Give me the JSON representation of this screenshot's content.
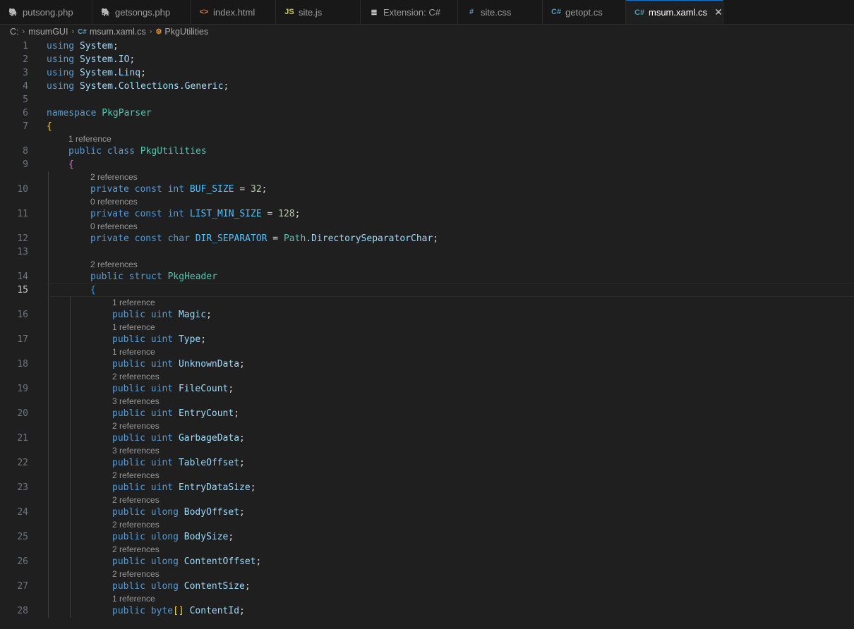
{
  "tabs": [
    {
      "name": "tab-putsong",
      "label": "putsong.php",
      "icon": "php-icon",
      "glyph": "🐘",
      "color": "#a074c4",
      "width": 131,
      "active": false
    },
    {
      "name": "tab-getsongs",
      "label": "getsongs.php",
      "icon": "php-icon",
      "glyph": "🐘",
      "color": "#a074c4",
      "width": 139,
      "active": false
    },
    {
      "name": "tab-index",
      "label": "index.html",
      "icon": "html-icon",
      "glyph": "<>",
      "color": "#e37933",
      "width": 121,
      "active": false
    },
    {
      "name": "tab-site-js",
      "label": "site.js",
      "icon": "js-icon",
      "glyph": "JS",
      "color": "#cbcb41",
      "width": 120,
      "active": false
    },
    {
      "name": "tab-extension",
      "label": "Extension: C#",
      "icon": "extension-icon",
      "glyph": "≣",
      "color": "#cccccc",
      "width": 138,
      "active": false
    },
    {
      "name": "tab-site-css",
      "label": "site.css",
      "icon": "css-icon",
      "glyph": "#",
      "color": "#519aba",
      "width": 120,
      "active": false
    },
    {
      "name": "tab-getopt",
      "label": "getopt.cs",
      "icon": "csharp-icon",
      "glyph": "C#",
      "color": "#519aba",
      "width": 118,
      "active": false
    },
    {
      "name": "tab-msum-xaml",
      "label": "msum.xaml.cs",
      "icon": "csharp-icon",
      "glyph": "C#",
      "color": "#519aba",
      "width": 138,
      "active": true,
      "close": "✕"
    }
  ],
  "breadcrumb": {
    "drive": "C:",
    "folder": "msumGUI",
    "file": "msum.xaml.cs",
    "symbol": "PkgUtilities",
    "separator": "›"
  },
  "editor": {
    "current_line": 15,
    "lines": [
      {
        "n": 1,
        "indent": 0,
        "tokens": [
          [
            "kw",
            "using"
          ],
          [
            "plain",
            " "
          ],
          [
            "ns",
            "System"
          ],
          [
            "plain",
            ";"
          ]
        ]
      },
      {
        "n": 2,
        "indent": 0,
        "tokens": [
          [
            "kw",
            "using"
          ],
          [
            "plain",
            " "
          ],
          [
            "ns",
            "System.IO"
          ],
          [
            "plain",
            ";"
          ]
        ]
      },
      {
        "n": 3,
        "indent": 0,
        "tokens": [
          [
            "kw",
            "using"
          ],
          [
            "plain",
            " "
          ],
          [
            "ns",
            "System.Linq"
          ],
          [
            "plain",
            ";"
          ]
        ]
      },
      {
        "n": 4,
        "indent": 0,
        "tokens": [
          [
            "kw",
            "using"
          ],
          [
            "plain",
            " "
          ],
          [
            "ns",
            "System.Collections.Generic"
          ],
          [
            "plain",
            ";"
          ]
        ]
      },
      {
        "n": 5,
        "indent": 0,
        "tokens": []
      },
      {
        "n": 6,
        "indent": 0,
        "tokens": [
          [
            "kw",
            "namespace"
          ],
          [
            "plain",
            " "
          ],
          [
            "ty",
            "PkgParser"
          ]
        ]
      },
      {
        "n": 7,
        "indent": 0,
        "tokens": [
          [
            "brace1",
            "{"
          ]
        ]
      },
      {
        "n": 8,
        "indent": 1,
        "lens": "1 reference",
        "tokens": [
          [
            "kw",
            "public"
          ],
          [
            "plain",
            " "
          ],
          [
            "kw",
            "class"
          ],
          [
            "plain",
            " "
          ],
          [
            "ty",
            "PkgUtilities"
          ]
        ]
      },
      {
        "n": 9,
        "indent": 1,
        "tokens": [
          [
            "brace2",
            "{"
          ]
        ]
      },
      {
        "n": 10,
        "indent": 2,
        "lens": "2 references",
        "tokens": [
          [
            "kw",
            "private"
          ],
          [
            "plain",
            " "
          ],
          [
            "kw",
            "const"
          ],
          [
            "plain",
            " "
          ],
          [
            "kw",
            "int"
          ],
          [
            "plain",
            " "
          ],
          [
            "const",
            "BUF_SIZE"
          ],
          [
            "plain",
            " = "
          ],
          [
            "num",
            "32"
          ],
          [
            "plain",
            ";"
          ]
        ]
      },
      {
        "n": 11,
        "indent": 2,
        "lens": "0 references",
        "tokens": [
          [
            "kw",
            "private"
          ],
          [
            "plain",
            " "
          ],
          [
            "kw",
            "const"
          ],
          [
            "plain",
            " "
          ],
          [
            "kw",
            "int"
          ],
          [
            "plain",
            " "
          ],
          [
            "const",
            "LIST_MIN_SIZE"
          ],
          [
            "plain",
            " = "
          ],
          [
            "num",
            "128"
          ],
          [
            "plain",
            ";"
          ]
        ]
      },
      {
        "n": 12,
        "indent": 2,
        "lens": "0 references",
        "tokens": [
          [
            "kw",
            "private"
          ],
          [
            "plain",
            " "
          ],
          [
            "kw",
            "const"
          ],
          [
            "plain",
            " "
          ],
          [
            "kw",
            "char"
          ],
          [
            "plain",
            " "
          ],
          [
            "const",
            "DIR_SEPARATOR"
          ],
          [
            "plain",
            " = "
          ],
          [
            "ty",
            "Path"
          ],
          [
            "plain",
            "."
          ],
          [
            "id",
            "DirectorySeparatorChar"
          ],
          [
            "plain",
            ";"
          ]
        ]
      },
      {
        "n": 13,
        "indent": 2,
        "tokens": []
      },
      {
        "n": 14,
        "indent": 2,
        "lens": "2 references",
        "tokens": [
          [
            "kw",
            "public"
          ],
          [
            "plain",
            " "
          ],
          [
            "kw",
            "struct"
          ],
          [
            "plain",
            " "
          ],
          [
            "ty",
            "PkgHeader"
          ]
        ]
      },
      {
        "n": 15,
        "indent": 2,
        "tokens": [
          [
            "brace3",
            "{"
          ]
        ]
      },
      {
        "n": 16,
        "indent": 3,
        "lens": "1 reference",
        "tokens": [
          [
            "kw",
            "public"
          ],
          [
            "plain",
            " "
          ],
          [
            "kw",
            "uint"
          ],
          [
            "plain",
            " "
          ],
          [
            "id",
            "Magic"
          ],
          [
            "plain",
            ";"
          ]
        ]
      },
      {
        "n": 17,
        "indent": 3,
        "lens": "1 reference",
        "tokens": [
          [
            "kw",
            "public"
          ],
          [
            "plain",
            " "
          ],
          [
            "kw",
            "uint"
          ],
          [
            "plain",
            " "
          ],
          [
            "id",
            "Type"
          ],
          [
            "plain",
            ";"
          ]
        ]
      },
      {
        "n": 18,
        "indent": 3,
        "lens": "1 reference",
        "tokens": [
          [
            "kw",
            "public"
          ],
          [
            "plain",
            " "
          ],
          [
            "kw",
            "uint"
          ],
          [
            "plain",
            " "
          ],
          [
            "id",
            "UnknownData"
          ],
          [
            "plain",
            ";"
          ]
        ]
      },
      {
        "n": 19,
        "indent": 3,
        "lens": "2 references",
        "tokens": [
          [
            "kw",
            "public"
          ],
          [
            "plain",
            " "
          ],
          [
            "kw",
            "uint"
          ],
          [
            "plain",
            " "
          ],
          [
            "id",
            "FileCount"
          ],
          [
            "plain",
            ";"
          ]
        ]
      },
      {
        "n": 20,
        "indent": 3,
        "lens": "3 references",
        "tokens": [
          [
            "kw",
            "public"
          ],
          [
            "plain",
            " "
          ],
          [
            "kw",
            "uint"
          ],
          [
            "plain",
            " "
          ],
          [
            "id",
            "EntryCount"
          ],
          [
            "plain",
            ";"
          ]
        ]
      },
      {
        "n": 21,
        "indent": 3,
        "lens": "2 references",
        "tokens": [
          [
            "kw",
            "public"
          ],
          [
            "plain",
            " "
          ],
          [
            "kw",
            "uint"
          ],
          [
            "plain",
            " "
          ],
          [
            "id",
            "GarbageData"
          ],
          [
            "plain",
            ";"
          ]
        ]
      },
      {
        "n": 22,
        "indent": 3,
        "lens": "3 references",
        "tokens": [
          [
            "kw",
            "public"
          ],
          [
            "plain",
            " "
          ],
          [
            "kw",
            "uint"
          ],
          [
            "plain",
            " "
          ],
          [
            "id",
            "TableOffset"
          ],
          [
            "plain",
            ";"
          ]
        ]
      },
      {
        "n": 23,
        "indent": 3,
        "lens": "2 references",
        "tokens": [
          [
            "kw",
            "public"
          ],
          [
            "plain",
            " "
          ],
          [
            "kw",
            "uint"
          ],
          [
            "plain",
            " "
          ],
          [
            "id",
            "EntryDataSize"
          ],
          [
            "plain",
            ";"
          ]
        ]
      },
      {
        "n": 24,
        "indent": 3,
        "lens": "2 references",
        "tokens": [
          [
            "kw",
            "public"
          ],
          [
            "plain",
            " "
          ],
          [
            "kw",
            "ulong"
          ],
          [
            "plain",
            " "
          ],
          [
            "id",
            "BodyOffset"
          ],
          [
            "plain",
            ";"
          ]
        ]
      },
      {
        "n": 25,
        "indent": 3,
        "lens": "2 references",
        "tokens": [
          [
            "kw",
            "public"
          ],
          [
            "plain",
            " "
          ],
          [
            "kw",
            "ulong"
          ],
          [
            "plain",
            " "
          ],
          [
            "id",
            "BodySize"
          ],
          [
            "plain",
            ";"
          ]
        ]
      },
      {
        "n": 26,
        "indent": 3,
        "lens": "2 references",
        "tokens": [
          [
            "kw",
            "public"
          ],
          [
            "plain",
            " "
          ],
          [
            "kw",
            "ulong"
          ],
          [
            "plain",
            " "
          ],
          [
            "id",
            "ContentOffset"
          ],
          [
            "plain",
            ";"
          ]
        ]
      },
      {
        "n": 27,
        "indent": 3,
        "lens": "2 references",
        "tokens": [
          [
            "kw",
            "public"
          ],
          [
            "plain",
            " "
          ],
          [
            "kw",
            "ulong"
          ],
          [
            "plain",
            " "
          ],
          [
            "id",
            "ContentSize"
          ],
          [
            "plain",
            ";"
          ]
        ]
      },
      {
        "n": 28,
        "indent": 3,
        "lens": "1 reference",
        "tokens": [
          [
            "kw",
            "public"
          ],
          [
            "plain",
            " "
          ],
          [
            "kw",
            "byte"
          ],
          [
            "brace1",
            "[]"
          ],
          [
            "plain",
            " "
          ],
          [
            "id",
            "ContentId"
          ],
          [
            "plain",
            ";"
          ]
        ]
      }
    ]
  }
}
